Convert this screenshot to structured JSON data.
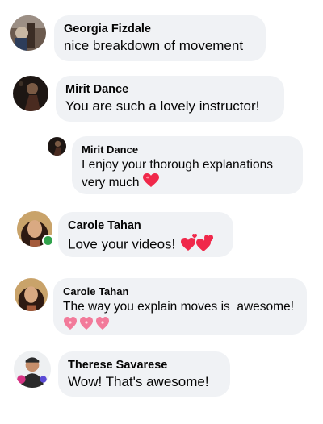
{
  "comments": [
    {
      "author": "Georgia Fizdale",
      "text": "nice breakdown of movement",
      "avatar_icon": "profile-photo"
    },
    {
      "author": "Mirit Dance",
      "text": "You are such a lovely instructor!",
      "avatar_icon": "profile-photo"
    },
    {
      "author": "Mirit Dance",
      "text": "I enjoy your thorough explanations very much",
      "avatar_icon": "profile-photo",
      "emoji": "red-heart"
    },
    {
      "author": "Carole Tahan",
      "text": "Love your videos!",
      "avatar_icon": "profile-photo",
      "online": true,
      "emoji": "two-hearts"
    },
    {
      "author": "Carole Tahan",
      "text": "The way you explain moves is  awesome!",
      "avatar_icon": "profile-photo",
      "emoji": "sparkling-hearts-x3"
    },
    {
      "author": "Therese Savarese",
      "text": "Wow! That's awesome!",
      "avatar_icon": "profile-photo"
    }
  ],
  "colors": {
    "bubble": "#f0f2f5",
    "online": "#31a24c",
    "heart": "#f0284a"
  }
}
